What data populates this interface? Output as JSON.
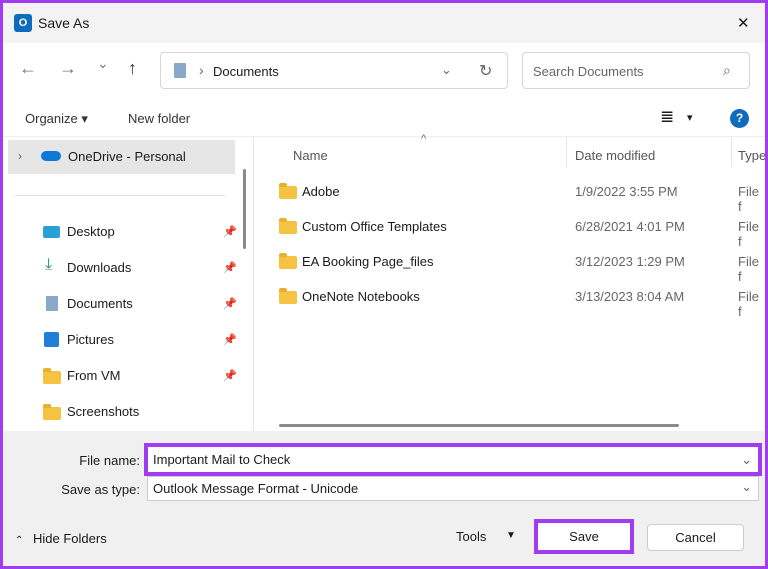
{
  "window": {
    "title": "Save As",
    "close": "✕"
  },
  "nav": {
    "back": "←",
    "forward": "→",
    "recent": "⌄",
    "up": "↑",
    "path_sep": "›",
    "path": "Documents",
    "refresh": "↻",
    "search_placeholder": "Search Documents"
  },
  "toolbar": {
    "organize": "Organize ▾",
    "new_folder": "New folder",
    "view": "≣",
    "view_chevron": "▾",
    "help": "?"
  },
  "sidebar": {
    "onedrive": "OneDrive - Personal",
    "items": [
      {
        "label": "Desktop",
        "pinned": true
      },
      {
        "label": "Downloads",
        "pinned": true
      },
      {
        "label": "Documents",
        "pinned": true
      },
      {
        "label": "Pictures",
        "pinned": true
      },
      {
        "label": "From VM",
        "pinned": true
      },
      {
        "label": "Screenshots",
        "pinned": false
      }
    ]
  },
  "columns": {
    "name": "Name",
    "date": "Date modified",
    "type": "Type"
  },
  "files": [
    {
      "name": "Adobe",
      "date": "1/9/2022 3:55 PM",
      "type": "File f"
    },
    {
      "name": "Custom Office Templates",
      "date": "6/28/2021 4:01 PM",
      "type": "File f"
    },
    {
      "name": "EA Booking Page_files",
      "date": "3/12/2023 1:29 PM",
      "type": "File f"
    },
    {
      "name": "OneNote Notebooks",
      "date": "3/13/2023 8:04 AM",
      "type": "File f"
    }
  ],
  "form": {
    "file_name_label": "File name:",
    "file_name": "Important Mail to Check",
    "type_label": "Save as type:",
    "type": "Outlook Message Format - Unicode"
  },
  "footer": {
    "hide_folders": "Hide Folders",
    "tools": "Tools",
    "save": "Save",
    "cancel": "Cancel"
  },
  "colors": {
    "highlight": "#a23cf0",
    "accent": "#0f6cbd"
  }
}
